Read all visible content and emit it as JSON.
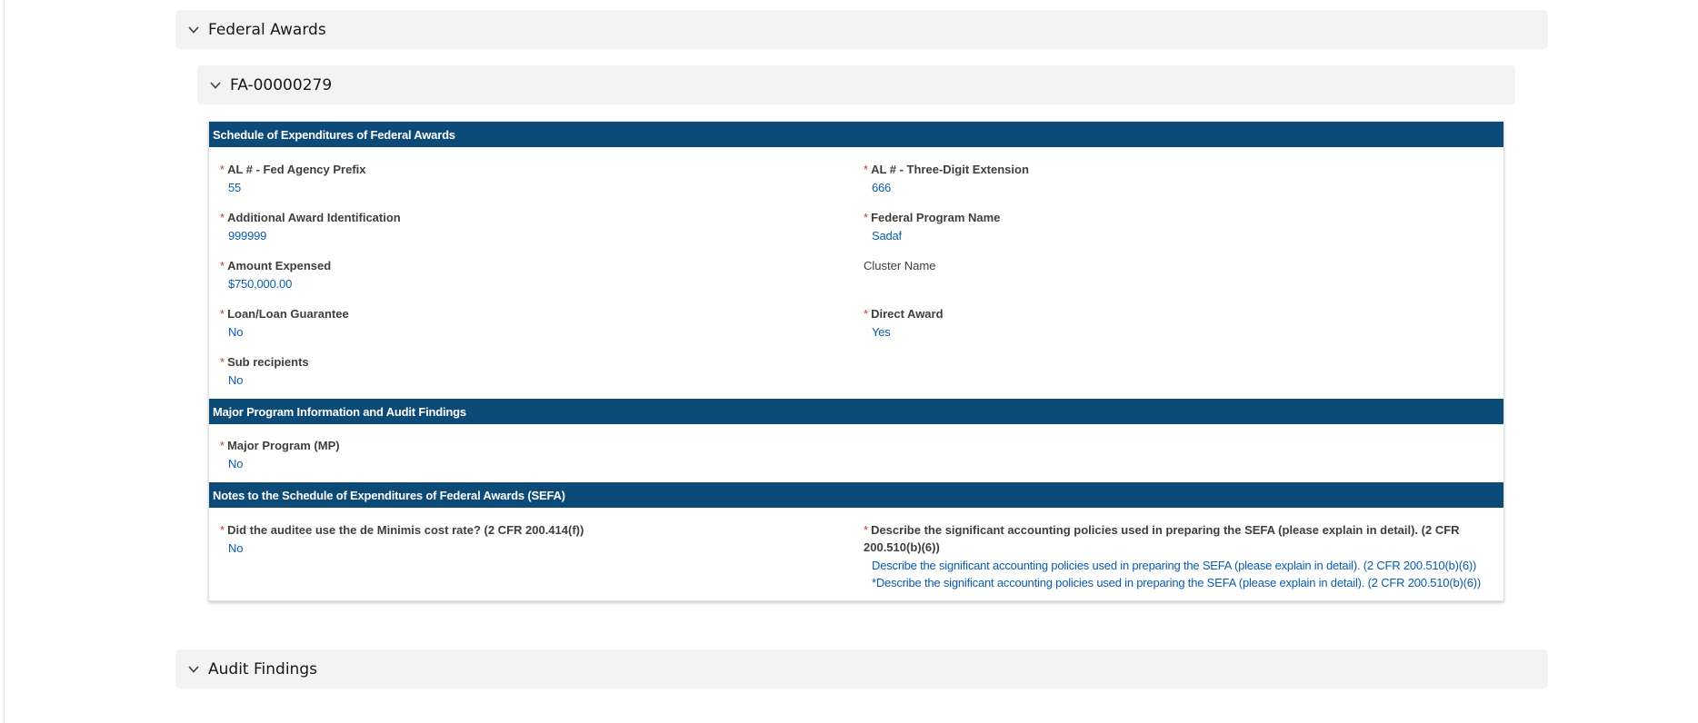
{
  "accordions": {
    "federal_awards": "Federal Awards",
    "fa_record": "FA-00000279",
    "audit_findings": "Audit Findings"
  },
  "sections": {
    "sefa": "Schedule of Expenditures of Federal Awards",
    "major_program": "Major Program Information and Audit Findings",
    "notes": "Notes to the Schedule of Expenditures of Federal Awards (SEFA)"
  },
  "required_marker": "*",
  "fields": {
    "al_prefix": {
      "label": "AL # - Fed Agency Prefix",
      "value": "55"
    },
    "al_extension": {
      "label": "AL # - Three-Digit Extension",
      "value": "666"
    },
    "additional_award_id": {
      "label": "Additional Award Identification",
      "value": "999999"
    },
    "federal_program_name": {
      "label": "Federal Program Name",
      "value": "Sadaf"
    },
    "amount_expensed": {
      "label": "Amount Expensed",
      "value": "$750,000.00"
    },
    "cluster_name": {
      "label": "Cluster Name",
      "value": ""
    },
    "loan_guarantee": {
      "label": "Loan/Loan Guarantee",
      "value": "No"
    },
    "direct_award": {
      "label": "Direct Award",
      "value": "Yes"
    },
    "sub_recipients": {
      "label": "Sub recipients",
      "value": "No"
    },
    "major_program": {
      "label": "Major Program (MP)",
      "value": "No"
    },
    "de_minimis": {
      "label": "Did the auditee use the de Minimis cost rate? (2 CFR 200.414(f))",
      "value": "No"
    },
    "accounting_policies": {
      "label": "Describe the significant accounting policies used in preparing the SEFA (please explain in detail). (2 CFR 200.510(b)(6))",
      "value_line1": "Describe the significant accounting policies used in preparing the SEFA (please explain in detail). (2 CFR 200.510(b)(6))",
      "value_line2": "*Describe the significant accounting policies used in preparing the SEFA (please explain in detail). (2 CFR 200.510(b)(6))"
    }
  },
  "colors": {
    "section_bar": "#0c4a78",
    "value_text": "#0b5cab",
    "required": "#c23934",
    "accordion_bg": "#f3f3f3"
  },
  "icons": {
    "accordion_toggle": "chevron-down-icon"
  }
}
